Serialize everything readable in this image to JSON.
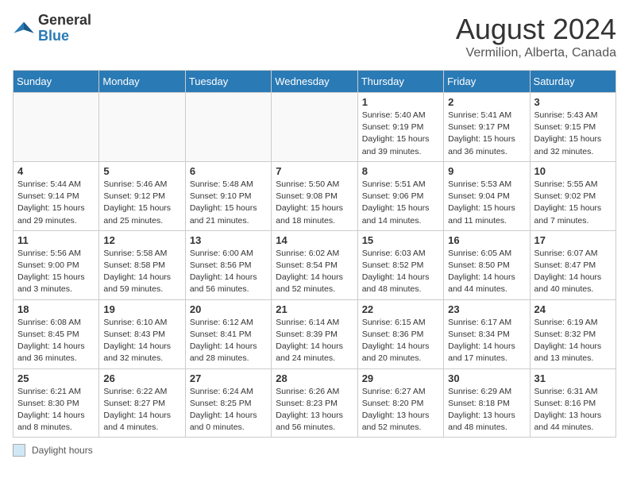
{
  "header": {
    "logo_general": "General",
    "logo_blue": "Blue",
    "month": "August 2024",
    "location": "Vermilion, Alberta, Canada"
  },
  "days_of_week": [
    "Sunday",
    "Monday",
    "Tuesday",
    "Wednesday",
    "Thursday",
    "Friday",
    "Saturday"
  ],
  "legend": {
    "label": "Daylight hours"
  },
  "weeks": [
    [
      {
        "day": "",
        "sunrise": "",
        "sunset": "",
        "daylight": ""
      },
      {
        "day": "",
        "sunrise": "",
        "sunset": "",
        "daylight": ""
      },
      {
        "day": "",
        "sunrise": "",
        "sunset": "",
        "daylight": ""
      },
      {
        "day": "",
        "sunrise": "",
        "sunset": "",
        "daylight": ""
      },
      {
        "day": "1",
        "sunrise": "Sunrise: 5:40 AM",
        "sunset": "Sunset: 9:19 PM",
        "daylight": "Daylight: 15 hours and 39 minutes."
      },
      {
        "day": "2",
        "sunrise": "Sunrise: 5:41 AM",
        "sunset": "Sunset: 9:17 PM",
        "daylight": "Daylight: 15 hours and 36 minutes."
      },
      {
        "day": "3",
        "sunrise": "Sunrise: 5:43 AM",
        "sunset": "Sunset: 9:15 PM",
        "daylight": "Daylight: 15 hours and 32 minutes."
      }
    ],
    [
      {
        "day": "4",
        "sunrise": "Sunrise: 5:44 AM",
        "sunset": "Sunset: 9:14 PM",
        "daylight": "Daylight: 15 hours and 29 minutes."
      },
      {
        "day": "5",
        "sunrise": "Sunrise: 5:46 AM",
        "sunset": "Sunset: 9:12 PM",
        "daylight": "Daylight: 15 hours and 25 minutes."
      },
      {
        "day": "6",
        "sunrise": "Sunrise: 5:48 AM",
        "sunset": "Sunset: 9:10 PM",
        "daylight": "Daylight: 15 hours and 21 minutes."
      },
      {
        "day": "7",
        "sunrise": "Sunrise: 5:50 AM",
        "sunset": "Sunset: 9:08 PM",
        "daylight": "Daylight: 15 hours and 18 minutes."
      },
      {
        "day": "8",
        "sunrise": "Sunrise: 5:51 AM",
        "sunset": "Sunset: 9:06 PM",
        "daylight": "Daylight: 15 hours and 14 minutes."
      },
      {
        "day": "9",
        "sunrise": "Sunrise: 5:53 AM",
        "sunset": "Sunset: 9:04 PM",
        "daylight": "Daylight: 15 hours and 11 minutes."
      },
      {
        "day": "10",
        "sunrise": "Sunrise: 5:55 AM",
        "sunset": "Sunset: 9:02 PM",
        "daylight": "Daylight: 15 hours and 7 minutes."
      }
    ],
    [
      {
        "day": "11",
        "sunrise": "Sunrise: 5:56 AM",
        "sunset": "Sunset: 9:00 PM",
        "daylight": "Daylight: 15 hours and 3 minutes."
      },
      {
        "day": "12",
        "sunrise": "Sunrise: 5:58 AM",
        "sunset": "Sunset: 8:58 PM",
        "daylight": "Daylight: 14 hours and 59 minutes."
      },
      {
        "day": "13",
        "sunrise": "Sunrise: 6:00 AM",
        "sunset": "Sunset: 8:56 PM",
        "daylight": "Daylight: 14 hours and 56 minutes."
      },
      {
        "day": "14",
        "sunrise": "Sunrise: 6:02 AM",
        "sunset": "Sunset: 8:54 PM",
        "daylight": "Daylight: 14 hours and 52 minutes."
      },
      {
        "day": "15",
        "sunrise": "Sunrise: 6:03 AM",
        "sunset": "Sunset: 8:52 PM",
        "daylight": "Daylight: 14 hours and 48 minutes."
      },
      {
        "day": "16",
        "sunrise": "Sunrise: 6:05 AM",
        "sunset": "Sunset: 8:50 PM",
        "daylight": "Daylight: 14 hours and 44 minutes."
      },
      {
        "day": "17",
        "sunrise": "Sunrise: 6:07 AM",
        "sunset": "Sunset: 8:47 PM",
        "daylight": "Daylight: 14 hours and 40 minutes."
      }
    ],
    [
      {
        "day": "18",
        "sunrise": "Sunrise: 6:08 AM",
        "sunset": "Sunset: 8:45 PM",
        "daylight": "Daylight: 14 hours and 36 minutes."
      },
      {
        "day": "19",
        "sunrise": "Sunrise: 6:10 AM",
        "sunset": "Sunset: 8:43 PM",
        "daylight": "Daylight: 14 hours and 32 minutes."
      },
      {
        "day": "20",
        "sunrise": "Sunrise: 6:12 AM",
        "sunset": "Sunset: 8:41 PM",
        "daylight": "Daylight: 14 hours and 28 minutes."
      },
      {
        "day": "21",
        "sunrise": "Sunrise: 6:14 AM",
        "sunset": "Sunset: 8:39 PM",
        "daylight": "Daylight: 14 hours and 24 minutes."
      },
      {
        "day": "22",
        "sunrise": "Sunrise: 6:15 AM",
        "sunset": "Sunset: 8:36 PM",
        "daylight": "Daylight: 14 hours and 20 minutes."
      },
      {
        "day": "23",
        "sunrise": "Sunrise: 6:17 AM",
        "sunset": "Sunset: 8:34 PM",
        "daylight": "Daylight: 14 hours and 17 minutes."
      },
      {
        "day": "24",
        "sunrise": "Sunrise: 6:19 AM",
        "sunset": "Sunset: 8:32 PM",
        "daylight": "Daylight: 14 hours and 13 minutes."
      }
    ],
    [
      {
        "day": "25",
        "sunrise": "Sunrise: 6:21 AM",
        "sunset": "Sunset: 8:30 PM",
        "daylight": "Daylight: 14 hours and 8 minutes."
      },
      {
        "day": "26",
        "sunrise": "Sunrise: 6:22 AM",
        "sunset": "Sunset: 8:27 PM",
        "daylight": "Daylight: 14 hours and 4 minutes."
      },
      {
        "day": "27",
        "sunrise": "Sunrise: 6:24 AM",
        "sunset": "Sunset: 8:25 PM",
        "daylight": "Daylight: 14 hours and 0 minutes."
      },
      {
        "day": "28",
        "sunrise": "Sunrise: 6:26 AM",
        "sunset": "Sunset: 8:23 PM",
        "daylight": "Daylight: 13 hours and 56 minutes."
      },
      {
        "day": "29",
        "sunrise": "Sunrise: 6:27 AM",
        "sunset": "Sunset: 8:20 PM",
        "daylight": "Daylight: 13 hours and 52 minutes."
      },
      {
        "day": "30",
        "sunrise": "Sunrise: 6:29 AM",
        "sunset": "Sunset: 8:18 PM",
        "daylight": "Daylight: 13 hours and 48 minutes."
      },
      {
        "day": "31",
        "sunrise": "Sunrise: 6:31 AM",
        "sunset": "Sunset: 8:16 PM",
        "daylight": "Daylight: 13 hours and 44 minutes."
      }
    ]
  ]
}
